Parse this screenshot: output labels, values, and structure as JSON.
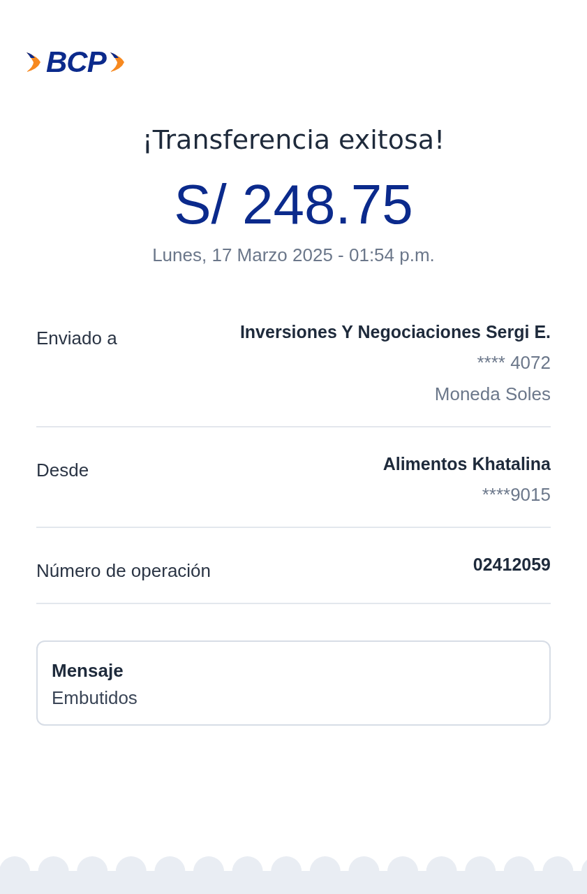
{
  "logo": {
    "text": "BCP"
  },
  "title": "¡Transferencia exitosa!",
  "amount": "S/ 248.75",
  "datetime": "Lunes, 17 Marzo 2025 - 01:54 p.m.",
  "details": [
    {
      "label": "Enviado a",
      "value": "Inversiones Y Negociaciones Sergi E.",
      "extra": [
        "**** 4072",
        "Moneda Soles"
      ]
    },
    {
      "label": "Desde",
      "value": "Alimentos Khatalina",
      "extra": [
        "****9015"
      ]
    },
    {
      "label": "Número de operación",
      "value": "02412059"
    }
  ],
  "message": {
    "title": "Mensaje",
    "text": "Embutidos"
  }
}
